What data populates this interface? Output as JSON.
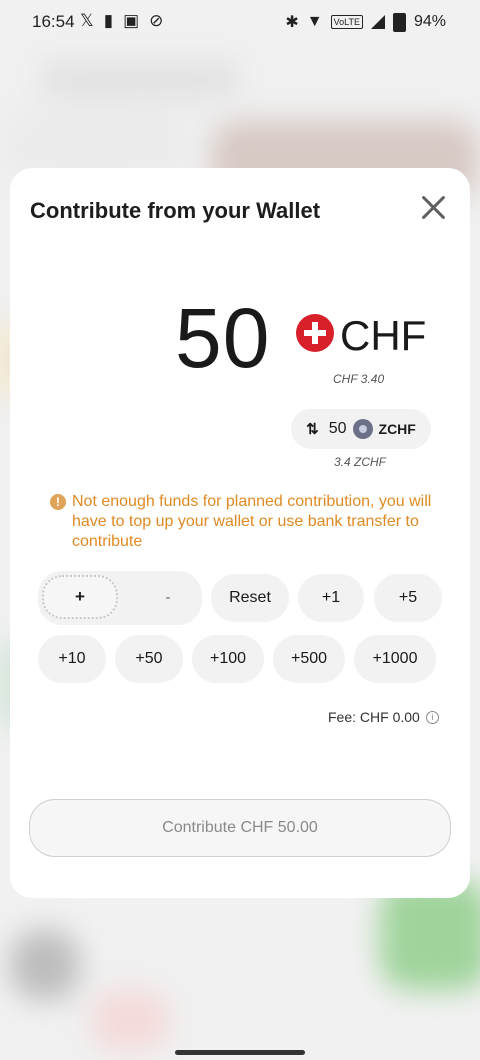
{
  "status_bar": {
    "time": "16:54",
    "left_icons": [
      "x-icon",
      "bookmark-icon",
      "news-icon",
      "blocked-icon"
    ],
    "right": {
      "bluetooth": "✱",
      "volte": "VoLTE",
      "battery": "94%"
    }
  },
  "sheet": {
    "title": "Contribute from your Wallet",
    "amount": "50",
    "currency": "CHF",
    "amount_chf_sub": "CHF 3.40",
    "conversion": {
      "value": "50",
      "token": "ZCHF",
      "sub": "3.4 ZCHF"
    },
    "warning": "Not enough funds for planned contribution, you will have to top up your wallet or use bank transfer to contribute",
    "toggle": {
      "plus": "+",
      "minus": "-"
    },
    "quick_buttons": [
      "Reset",
      "+1",
      "+5",
      "+10",
      "+50",
      "+100",
      "+500",
      "+1000"
    ],
    "fee": "Fee: CHF 0.00",
    "cta": "Contribute CHF 50.00"
  },
  "colors": {
    "warning": "#e08a24",
    "swiss_red": "#d8202a"
  }
}
